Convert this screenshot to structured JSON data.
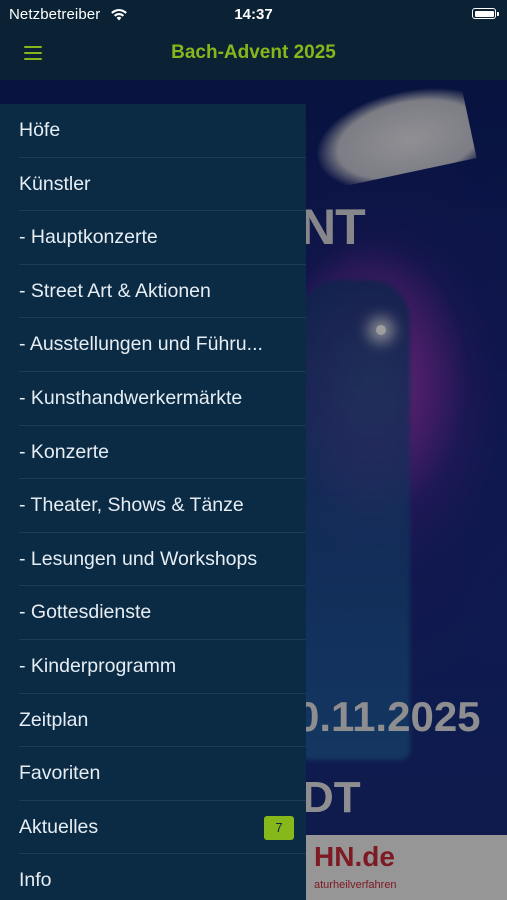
{
  "status_bar": {
    "carrier": "Netzbetreiber",
    "time": "14:37"
  },
  "nav": {
    "title": "Bach-Advent 2025"
  },
  "poster": {
    "text_a": "NT",
    "date": "0.11.2025",
    "text_b": "DT",
    "footer_url": "HN.de",
    "footer_sub": "aturheilverfahren"
  },
  "menu": {
    "items": [
      {
        "label": "Höfe"
      },
      {
        "label": "Künstler"
      },
      {
        "label": "- Hauptkonzerte"
      },
      {
        "label": "- Street Art & Aktionen"
      },
      {
        "label": "- Ausstellungen und Führu..."
      },
      {
        "label": "- Kunsthandwerkermärkte"
      },
      {
        "label": "- Konzerte"
      },
      {
        "label": "- Theater, Shows & Tänze"
      },
      {
        "label": "- Lesungen und Workshops"
      },
      {
        "label": "- Gottesdienste"
      },
      {
        "label": "- Kinderprogramm"
      },
      {
        "label": "Zeitplan"
      },
      {
        "label": "Favoriten"
      },
      {
        "label": "Aktuelles",
        "badge": "7"
      },
      {
        "label": "Info"
      }
    ]
  },
  "colors": {
    "accent": "#86b81c",
    "drawer_bg": "#0b2b45",
    "header_bg": "#0a2234"
  }
}
